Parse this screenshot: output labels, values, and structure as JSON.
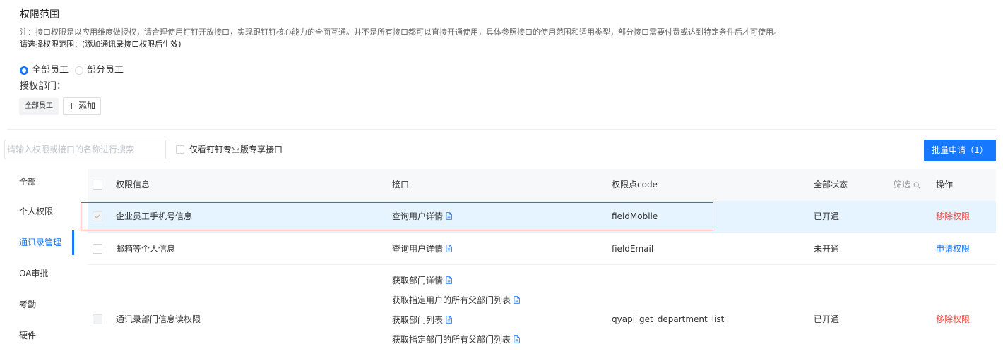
{
  "scope": {
    "title": "权限范围",
    "note": "注：接口权限是以应用维度做授权，请合理使用钉钉开放接口，实现跟钉钉核心能力的全面互通。并不是所有接口都可以直接开通使用，具体参照接口的使用范围和适用类型，部分接口需要付费或达到特定条件后才可使用。",
    "select_prompt": "请选择权限范围：(添加通讯录接口权限后生效)",
    "options": [
      {
        "label": "全部员工",
        "selected": true
      },
      {
        "label": "部分员工",
        "selected": false
      }
    ],
    "dept_label": "授权部门：",
    "dept_tags": [
      "全部员工"
    ],
    "add_label": "添加"
  },
  "toolbar": {
    "search_placeholder": "请输入权限或接口的名称进行搜索",
    "pro_only_label": "仅看钉钉专业版专享接口",
    "pro_only_checked": false,
    "batch_apply_label": "批量申请（1）"
  },
  "sidebar": {
    "items": [
      {
        "label": "全部",
        "active": false
      },
      {
        "label": "个人权限",
        "active": false
      },
      {
        "label": "通讯录管理",
        "active": true
      },
      {
        "label": "OA审批",
        "active": false
      },
      {
        "label": "考勤",
        "active": false
      },
      {
        "label": "硬件",
        "active": false
      }
    ]
  },
  "table": {
    "headers": {
      "info": "权限信息",
      "api": "接口",
      "code": "权限点code",
      "status": "全部状态",
      "filter": "筛选",
      "action": "操作"
    },
    "select_all_checked": false,
    "rows": [
      {
        "name": "企业员工手机号信息",
        "interfaces": [
          "查询用户详情"
        ],
        "code": "fieldMobile",
        "status": "已开通",
        "action": "移除权限",
        "action_color": "#f5483d",
        "checked": true,
        "disabled": true,
        "highlighted": true,
        "outlined": true
      },
      {
        "name": "邮箱等个人信息",
        "interfaces": [
          "查询用户详情"
        ],
        "code": "fieldEmail",
        "status": "未开通",
        "action": "申请权限",
        "action_color": "#1677ff",
        "checked": false,
        "disabled": false,
        "highlighted": false,
        "outlined": false
      },
      {
        "name": "通讯录部门信息读权限",
        "interfaces": [
          "获取部门详情",
          "获取指定用户的所有父部门列表",
          "获取部门列表",
          "获取指定部门的所有父部门列表"
        ],
        "code": "qyapi_get_department_list",
        "status": "已开通",
        "action": "移除权限",
        "action_color": "#f5483d",
        "checked": false,
        "disabled": true,
        "highlighted": false,
        "outlined": false
      }
    ]
  },
  "colors": {
    "accent": "#1677ff",
    "danger": "#f5483d",
    "highlight": "#e6f4ff",
    "outline": "#e53935",
    "header-bg": "#f7f8fa"
  },
  "icons": {
    "radio": "radio-icon",
    "checkbox": "checkbox-icon",
    "plus": "plus-icon",
    "search": "search-icon",
    "doc": "document-link-icon",
    "check": "check-icon"
  }
}
